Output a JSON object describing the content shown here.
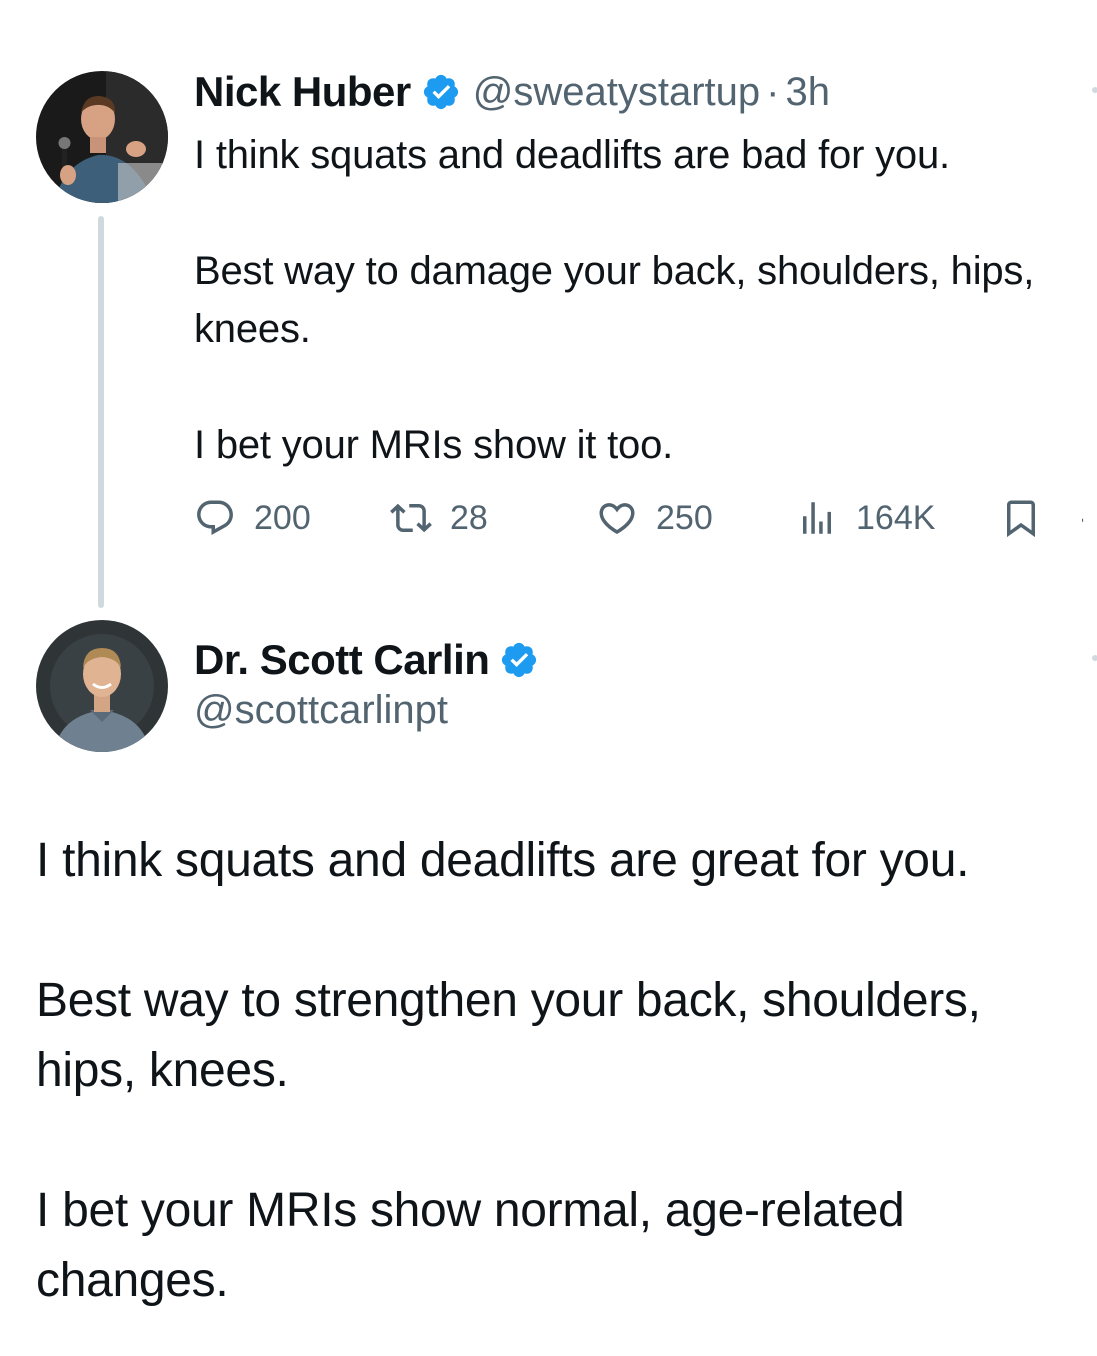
{
  "colors": {
    "text": "#0f1419",
    "secondary": "#536471",
    "verified": "#1d9bf0",
    "thread_line": "#cfd9de"
  },
  "original_tweet": {
    "author_name": "Nick Huber",
    "verified_icon": "verified-badge-icon",
    "handle": "@sweatystartup",
    "separator": "·",
    "time": "3h",
    "paragraphs": [
      "I think squats and deadlifts are bad for you.",
      "Best way to damage your back, shoulders, hips, knees.",
      "I bet your MRIs show it too."
    ],
    "actions": {
      "reply": {
        "icon": "reply-icon",
        "count": "200"
      },
      "retweet": {
        "icon": "retweet-icon",
        "count": "28"
      },
      "like": {
        "icon": "heart-icon",
        "count": "250"
      },
      "views": {
        "icon": "views-chart-icon",
        "count": "164K"
      },
      "bookmark": {
        "icon": "bookmark-icon"
      },
      "share": {
        "icon": "share-icon"
      }
    }
  },
  "reply_tweet": {
    "author_name": "Dr. Scott Carlin",
    "verified_icon": "verified-badge-icon",
    "handle": "@scottcarlinpt",
    "paragraphs": [
      "I think squats and deadlifts are great for you.",
      "Best way to strengthen your back, shoulders, hips, knees.",
      "I bet your MRIs show normal, age-related changes."
    ]
  }
}
